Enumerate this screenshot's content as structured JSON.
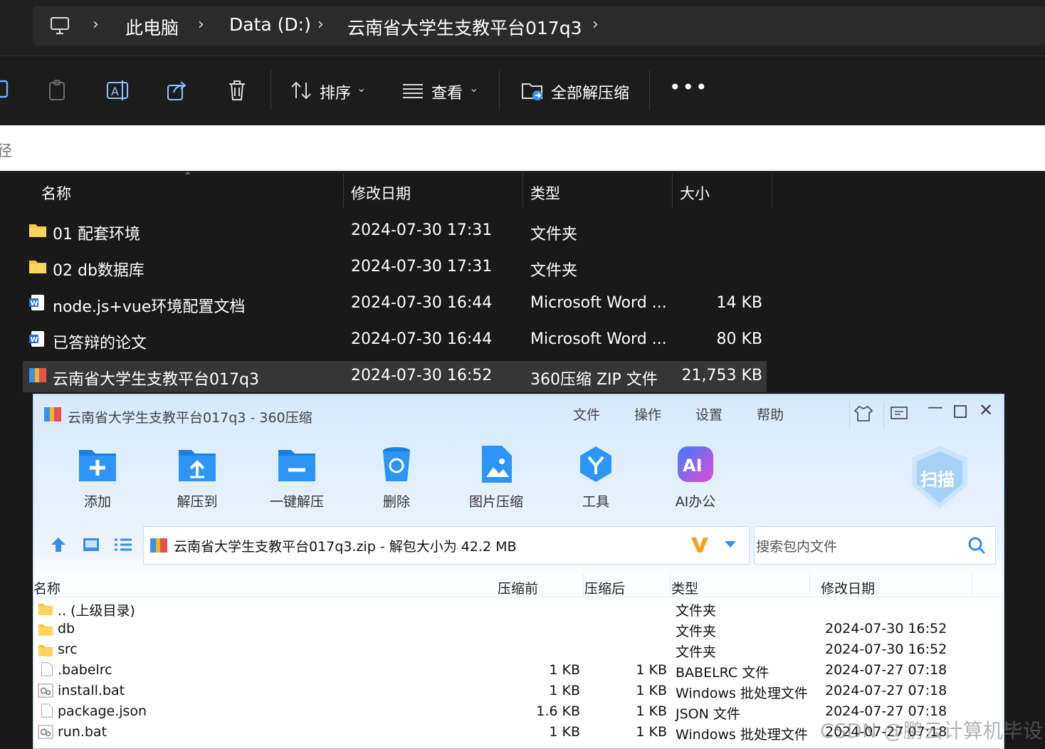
{
  "explorer": {
    "breadcrumb": [
      "此电脑",
      "Data (D:)",
      "云南省大学生支教平台017q3"
    ],
    "toolbar": {
      "sort_label": "排序",
      "view_label": "查看",
      "extract_all_label": "全部解压缩"
    },
    "path_placeholder": "径",
    "columns": [
      "名称",
      "修改日期",
      "类型",
      "大小"
    ],
    "files": [
      {
        "name": "01 配套环境",
        "date": "2024-07-30 17:31",
        "type": "文件夹",
        "size": "",
        "icon": "folder-icon"
      },
      {
        "name": "02 db数据库",
        "date": "2024-07-30 17:31",
        "type": "文件夹",
        "size": "",
        "icon": "folder-icon"
      },
      {
        "name": "node.js+vue环境配置文档",
        "date": "2024-07-30 16:44",
        "type": "Microsoft Word ...",
        "size": "14 KB",
        "icon": "word-icon"
      },
      {
        "name": "已答辩的论文",
        "date": "2024-07-30 16:44",
        "type": "Microsoft Word ...",
        "size": "80 KB",
        "icon": "word-icon"
      },
      {
        "name": "云南省大学生支教平台017q3",
        "date": "2024-07-30 16:52",
        "type": "360压缩 ZIP 文件",
        "size": "21,753 KB",
        "icon": "zip-icon"
      }
    ]
  },
  "zipwin": {
    "title": "云南省大学生支教平台017q3 - 360压缩",
    "menu": [
      "文件",
      "操作",
      "设置",
      "帮助"
    ],
    "buttons": [
      "添加",
      "解压到",
      "一键解压",
      "删除",
      "图片压缩",
      "工具",
      "AI办公"
    ],
    "scan_label": "扫描",
    "ai_badge": "AI",
    "address": "云南省大学生支教平台017q3.zip - 解包大小为 42.2 MB",
    "search_placeholder": "搜索包内文件",
    "columns": [
      "名称",
      "压缩前",
      "压缩后",
      "类型",
      "修改日期"
    ],
    "entries": [
      {
        "name": ".. (上级目录)",
        "before": "",
        "after": "",
        "type": "文件夹",
        "date": "",
        "icon": "folder-icon"
      },
      {
        "name": "db",
        "before": "",
        "after": "",
        "type": "文件夹",
        "date": "2024-07-30 16:52",
        "icon": "folder-icon"
      },
      {
        "name": "src",
        "before": "",
        "after": "",
        "type": "文件夹",
        "date": "2024-07-30 16:52",
        "icon": "folder-icon"
      },
      {
        "name": ".babelrc",
        "before": "1 KB",
        "after": "1 KB",
        "type": "BABELRC 文件",
        "date": "2024-07-27 07:18",
        "icon": "file-icon"
      },
      {
        "name": "install.bat",
        "before": "1 KB",
        "after": "1 KB",
        "type": "Windows 批处理文件",
        "date": "2024-07-27 07:18",
        "icon": "batch-file-icon"
      },
      {
        "name": "package.json",
        "before": "1.6 KB",
        "after": "1 KB",
        "type": "JSON 文件",
        "date": "2024-07-27 07:18",
        "icon": "file-icon"
      },
      {
        "name": "run.bat",
        "before": "1 KB",
        "after": "1 KB",
        "type": "Windows 批处理文件",
        "date": "2024-07-27 07:18",
        "icon": "batch-file-icon"
      }
    ]
  },
  "watermark": "CSDN @鹏云计算机毕设"
}
